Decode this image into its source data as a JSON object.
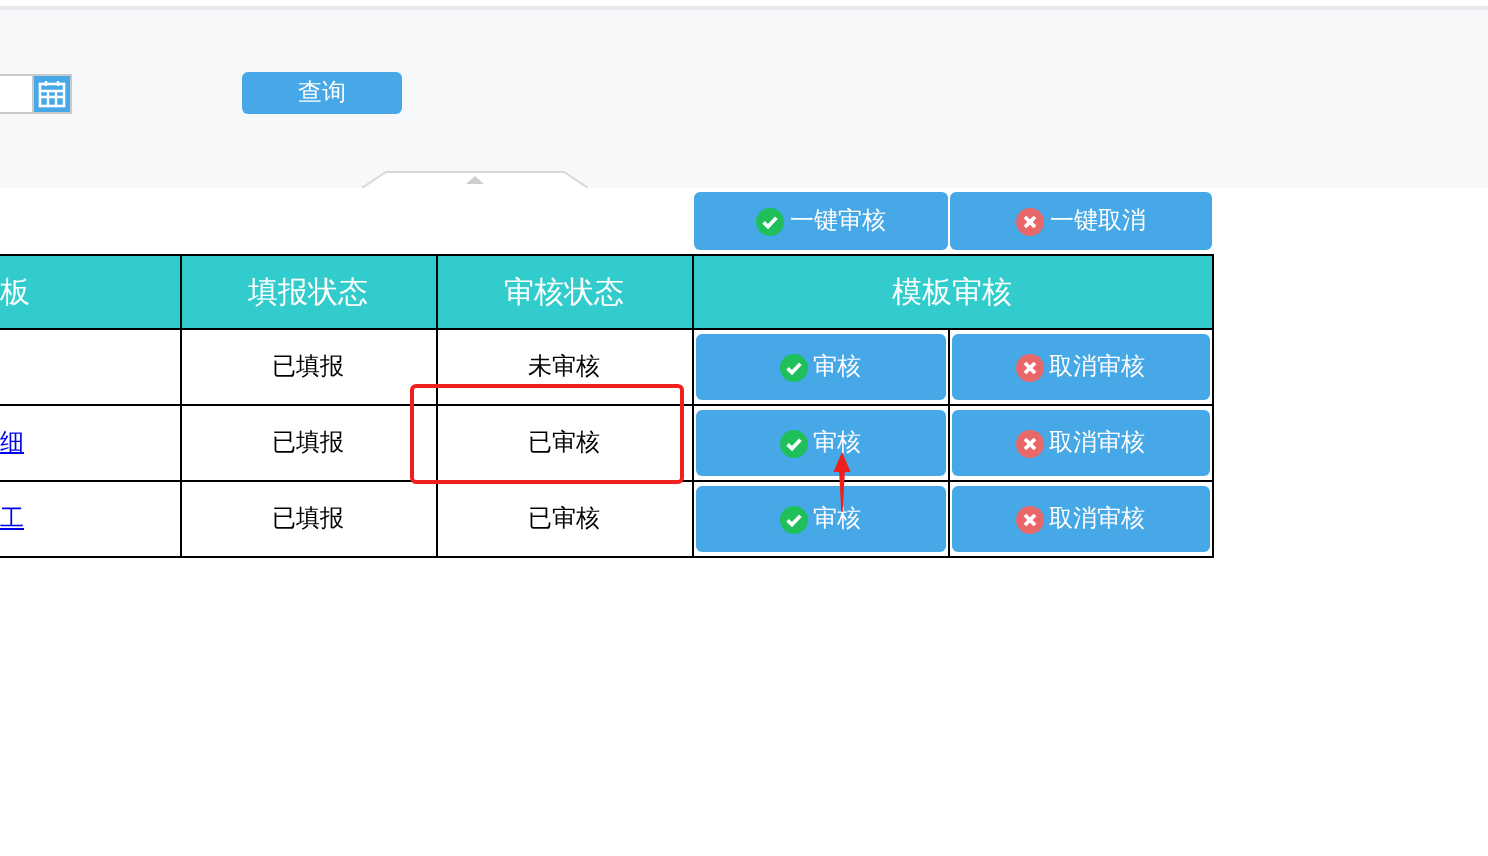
{
  "query_button": "查询",
  "bulk_actions": [
    {
      "kind": "approve",
      "label": "一键审核"
    },
    {
      "kind": "cancel",
      "label": "一键取消"
    }
  ],
  "table": {
    "columns": [
      "板",
      "填报状态",
      "审核状态",
      "模板审核"
    ],
    "rows": [
      {
        "template": "",
        "fill_status": "已填报",
        "review_status": "未审核",
        "actions": [
          {
            "kind": "approve",
            "label": "审核"
          },
          {
            "kind": "cancel",
            "label": "取消审核"
          }
        ]
      },
      {
        "template": "细",
        "fill_status": "已填报",
        "review_status": "已审核",
        "actions": [
          {
            "kind": "approve",
            "label": "审核"
          },
          {
            "kind": "cancel",
            "label": "取消审核"
          }
        ]
      },
      {
        "template": "工",
        "fill_status": "已填报",
        "review_status": "已审核",
        "actions": [
          {
            "kind": "approve",
            "label": "审核"
          },
          {
            "kind": "cancel",
            "label": "取消审核"
          }
        ]
      }
    ]
  }
}
